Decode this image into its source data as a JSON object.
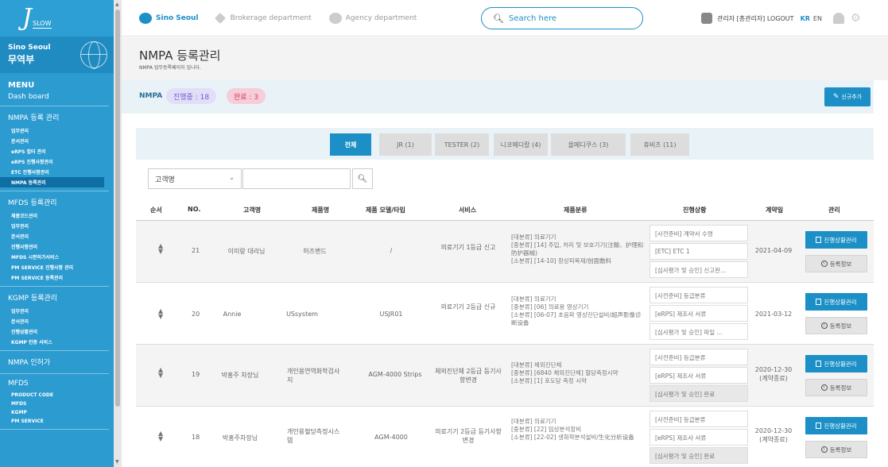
{
  "sidebar": {
    "logo_mark": "J",
    "logo_text": "SLOW",
    "company_line1": "Sino Seoul",
    "company_line2": "무역부",
    "menu_title": "MENU",
    "dashboard": "Dash board",
    "sections": [
      {
        "title": "NMPA 등록 관리",
        "items": [
          "업무관리",
          "문서관리",
          "eRPS 접터 관리",
          "eRPS 진행사항관리",
          "ETC 진행사항관리",
          "NMPA 등록관리"
        ],
        "active": 5
      },
      {
        "title": "MFDS 등록관리",
        "items": [
          "제품코드관리",
          "업무관리",
          "문서관리",
          "진행사항관리",
          "MFDS 시판허가서비스",
          "PM SERVICE 진행사항 관리",
          "PM SERVICE 등록관리"
        ],
        "active": -1
      },
      {
        "title": "KGMP 등록관리",
        "items": [
          "업무관리",
          "문서관리",
          "진행상황관리",
          "KGMP 인증 서비스"
        ],
        "active": -1
      },
      {
        "title": "NMPA 인허가",
        "items": [],
        "active": -1
      },
      {
        "title": "MFDS",
        "items": [
          "PRODUCT CODE",
          "MFDS",
          "KGMP",
          "PM SERVICE"
        ],
        "active": -1
      }
    ]
  },
  "topbar": {
    "link_sino": "Sino Seoul",
    "link_brokerage": "Brokerage department",
    "link_agency": "Agency department",
    "search_placeholder": "Search here",
    "user_label": "관리자 [총관리자] LOGOUT",
    "lang_kr": "KR",
    "lang_en": "EN"
  },
  "header": {
    "title": "NMPA 등록관리",
    "subtitle": "NMPA 업무등록페이지 입니다."
  },
  "status": {
    "label": "NMPA",
    "in_progress": "진행중 : 18",
    "completed": "완료 : 3",
    "new_button": "신규추가"
  },
  "tabs": [
    {
      "label": "전체"
    },
    {
      "label": "JR (1)"
    },
    {
      "label": "TESTER (2)"
    },
    {
      "label": "니코메디칼 (4)"
    },
    {
      "label": "올메디쿠스 (3)"
    },
    {
      "label": "휴비츠 (11)"
    }
  ],
  "filter": {
    "select_value": "고객명"
  },
  "table": {
    "headers": [
      "순서",
      "NO.",
      "고객명",
      "제품명",
      "제품 모델/타입",
      "서비스",
      "제품분류",
      "진행상황",
      "계약일",
      "관리"
    ],
    "manage_button": "진행상황관리",
    "info_button": "등록정보",
    "rows": [
      {
        "no": "21",
        "customer": "이미랑 대리님",
        "product": "허즈밴드",
        "model": "/",
        "service": "의료기기 1등급 신고",
        "category": [
          "[대분류] 의료기기",
          "[중분류] [14] 주입, 처리 및 보호기기(注輸、护理和防护器械)",
          "[소분류] [14-10] 창상피복제/创面敷料"
        ],
        "progress": [
          "[사전준비] 계약서 수령",
          "[ETC] ETC 1",
          "[심사평가 및 승인] 신고완…"
        ],
        "progress_grey": [
          false,
          false,
          false
        ],
        "date": "2021-04-09",
        "date_note": ""
      },
      {
        "no": "20",
        "customer": "Annie",
        "product": "USsystem",
        "model": "USJR01",
        "service": "의료기기 2등급 신규",
        "category": [
          "[대분류] 의료기기",
          "[중분류] [06] 의료용 영상기기",
          "[소분류] [06-07] 초음파 영상진단설비/超声影像诊断设备"
        ],
        "progress": [
          "[사전준비] 등급분류",
          "[eRPS] 제조사 서류",
          "[심사평가 및 승인] 파일 …"
        ],
        "progress_grey": [
          false,
          false,
          false
        ],
        "date": "2021-03-12",
        "date_note": ""
      },
      {
        "no": "19",
        "customer": "박홍주 차장님",
        "product": "개인용연역화학검사지",
        "model": "AGM-4000 Strips",
        "service": "체외진단체 2등급 등기사항변경",
        "category": [
          "[대분류] 체외진단체",
          "[중분류] [6840 체외진단체] 혈당측정시약",
          "[소분류] [1] 포도당 측정 시약"
        ],
        "progress": [
          "[사전준비] 등급분류",
          "[eRPS] 제조사 서류",
          "[심사평가 및 승인] 완료"
        ],
        "progress_grey": [
          false,
          false,
          true
        ],
        "date": "2020-12-30",
        "date_note": "(계약종료)"
      },
      {
        "no": "18",
        "customer": "박홍주차장님",
        "product": "개인용혈당측정시스템",
        "model": "AGM-4000",
        "service": "의료기기 2등급 등기사항변경",
        "category": [
          "[대분류] 의료기기",
          "[중분류] [22] 임상분석장비",
          "[소분류] [22-02] 생화학분석설비/生化分析设备"
        ],
        "progress": [
          "[사전준비] 등급분류",
          "[eRPS] 제조사 서류",
          "[심사평가 및 승인] 완료"
        ],
        "progress_grey": [
          false,
          false,
          true
        ],
        "date": "2020-12-30",
        "date_note": "(계약종료)"
      }
    ]
  }
}
